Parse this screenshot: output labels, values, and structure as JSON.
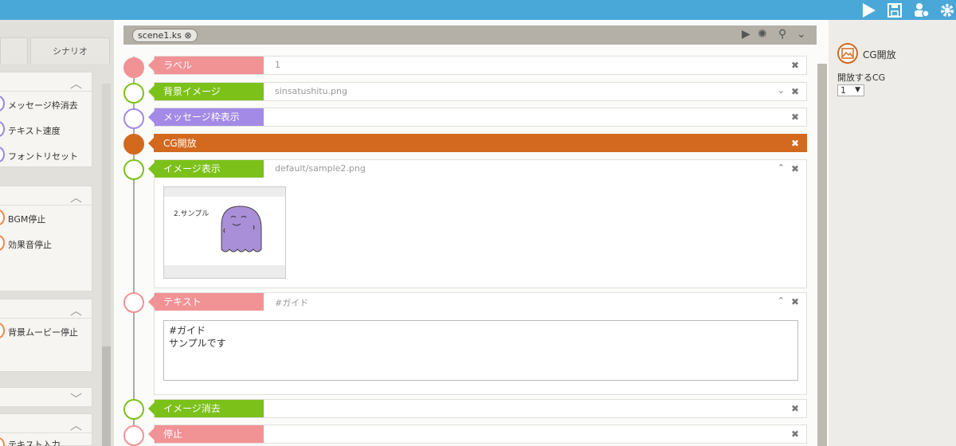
{
  "toolbar": {
    "icons": [
      "play-icon",
      "save-icon",
      "users-gear-icon",
      "settings-gear-icon"
    ]
  },
  "left": {
    "tabs": [
      "",
      "シナリオ"
    ],
    "groups": [
      {
        "items": [
          "メッセージ枠消去",
          "テキスト速度",
          "フォントリセット"
        ]
      },
      {
        "items": [
          "BGM停止",
          "効果音停止"
        ]
      },
      {
        "items": [
          "背景ムービー停止"
        ]
      },
      {
        "items": []
      },
      {
        "items": [
          "テキスト入力"
        ]
      }
    ]
  },
  "editor": {
    "file_tab": "scene1.ks",
    "rows": [
      {
        "tag": "ラベル",
        "value": "1",
        "color": "#f19295"
      },
      {
        "tag": "背景イメージ",
        "value": "sinsatushitu.png",
        "color": "#7cc11a"
      },
      {
        "tag": "メッセージ枠表示",
        "value": "",
        "color": "#a38ae6"
      },
      {
        "tag": "CG開放",
        "value": "",
        "color": "#d2691e"
      },
      {
        "tag": "イメージ表示",
        "value": "default/sample2.png",
        "color": "#7cc11a"
      },
      {
        "tag": "テキスト",
        "value": "#ガイド",
        "color": "#f19295"
      },
      {
        "tag": "イメージ消去",
        "value": "",
        "color": "#7cc11a"
      },
      {
        "tag": "停止",
        "value": "",
        "color": "#f19295"
      }
    ],
    "text_content": "#ガイド\nサンプルです",
    "thumbnail_caption": "2.サンプル"
  },
  "right": {
    "title": "CG開放",
    "field_label": "開放するCG",
    "select_value": "1"
  }
}
